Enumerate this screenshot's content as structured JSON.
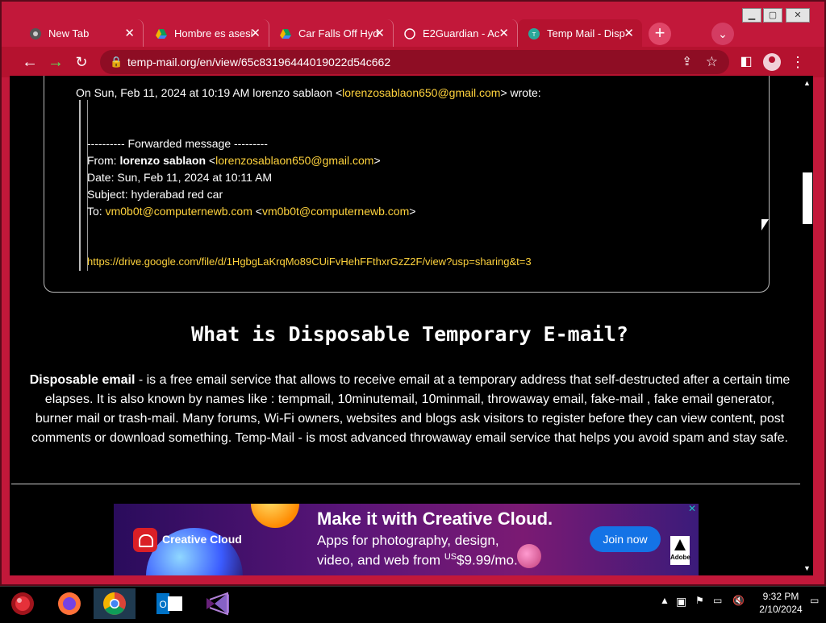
{
  "browser": {
    "tabs": [
      {
        "title": "New Tab",
        "icon": "chrome-icon"
      },
      {
        "title": "Hombre es asesi",
        "icon": "google-drive-icon"
      },
      {
        "title": "Car Falls Off Hyd",
        "icon": "google-drive-icon"
      },
      {
        "title": "E2Guardian - Ac",
        "icon": "page-icon"
      },
      {
        "title": "Temp Mail - Disp",
        "icon": "temp-mail-icon",
        "active": true
      }
    ],
    "url": "temp-mail.org/en/view/65c83196444019022d54c662",
    "window_controls": {
      "minimize": "▁",
      "maximize": "▢",
      "close": "✕"
    }
  },
  "email": {
    "wrote_prefix": "On Sun, Feb 11, 2024 at 10:19 AM lorenzo sablaon <",
    "wrote_email": "lorenzosablaon650@gmail.com",
    "wrote_suffix": "> wrote:",
    "forward_header": "---------- Forwarded message ---------",
    "from_label": "From: ",
    "from_name": "lorenzo sablaon",
    "from_email": "lorenzosablaon650@gmail.com",
    "date_line": "Date: Sun, Feb 11, 2024 at 10:11 AM",
    "subject_line": "Subject: hyderabad red car",
    "to_label": "To: ",
    "to_email1": "vm0b0t@computernewb.com",
    "to_email2": "vm0b0t@computernewb.com",
    "drive_link": "https://drive.google.com/file/d/1HgbgLaKrqMo89CUiFvHehFFthxrGzZ2F/view?usp=sharing&t=3"
  },
  "article": {
    "heading": "What is Disposable Temporary E-mail?",
    "bold_intro": "Disposable email",
    "body": " - is a free email service that allows to receive email at a temporary address that self-destructed after a certain time elapses. It is also known by names like : tempmail, 10minutemail, 10minmail, throwaway email, fake-mail , fake email generator, burner mail or trash-mail. Many forums, Wi-Fi owners, websites and blogs ask visitors to register before they can view content, post comments or download something. Temp-Mail - is most advanced throwaway email service that helps you avoid spam and stay safe."
  },
  "ad": {
    "brand": "Creative Cloud",
    "headline": "Make it with Creative Cloud.",
    "line1": "Apps for photography, design,",
    "line2_prefix": "video, and web from ",
    "currency": "US",
    "price": "$9.99/mo.",
    "cta": "Join now",
    "vendor": "Adobe"
  },
  "taskbar": {
    "time": "9:32 PM",
    "date": "2/10/2024"
  }
}
